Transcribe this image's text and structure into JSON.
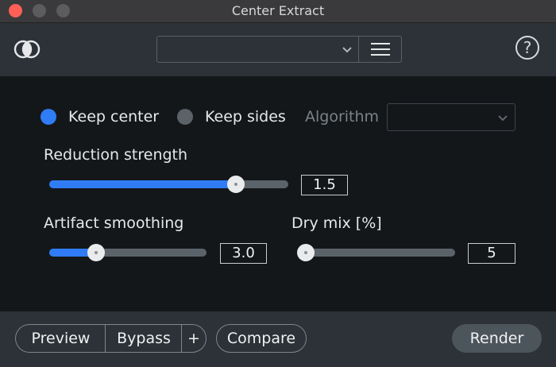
{
  "window": {
    "title": "Center Extract"
  },
  "header": {
    "preset_value": "",
    "help_label": "?"
  },
  "mode": {
    "keep_center_label": "Keep center",
    "keep_center_selected": true,
    "keep_sides_label": "Keep sides",
    "keep_sides_selected": false,
    "algorithm_label": "Algorithm",
    "algorithm_value": ""
  },
  "controls": {
    "reduction_strength": {
      "label": "Reduction strength",
      "value": "1.5",
      "fraction": 0.78
    },
    "artifact_smoothing": {
      "label": "Artifact smoothing",
      "value": "3.0",
      "fraction": 0.3
    },
    "dry_mix": {
      "label": "Dry mix [%]",
      "value": "5",
      "fraction": 0.0
    }
  },
  "footer": {
    "preview_label": "Preview",
    "bypass_label": "Bypass",
    "plus_label": "+",
    "compare_label": "Compare",
    "render_label": "Render"
  },
  "colors": {
    "accent": "#2f7cf6",
    "close": "#fe5f57"
  }
}
